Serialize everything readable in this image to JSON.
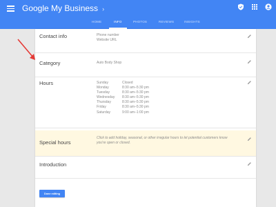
{
  "app": {
    "brand": "Google My Business",
    "brand_chevron": "›",
    "top_icons": [
      "shield-check-icon",
      "apps-grid-icon",
      "account-icon"
    ]
  },
  "tabs": [
    {
      "label": "HOME",
      "active": false
    },
    {
      "label": "INFO",
      "active": true
    },
    {
      "label": "PHOTOS",
      "active": false
    },
    {
      "label": "REVIEWS",
      "active": false
    },
    {
      "label": "INSIGHTS",
      "active": false
    }
  ],
  "contact": {
    "label": "Contact info",
    "phone_placeholder": "Phone number",
    "website_placeholder": "Website URL"
  },
  "category": {
    "label": "Category",
    "value": "Auto Body Shop"
  },
  "hours": {
    "label": "Hours",
    "days": [
      {
        "day": "Sunday",
        "time": "Closed"
      },
      {
        "day": "Monday",
        "time": "8:30 am–5:30 pm"
      },
      {
        "day": "Tuesday",
        "time": "8:30 am–5:30 pm"
      },
      {
        "day": "Wednesday",
        "time": "8:30 am–5:30 pm"
      },
      {
        "day": "Thursday",
        "time": "8:30 am–5:30 pm"
      },
      {
        "day": "Friday",
        "time": "8:30 am–5:30 pm"
      },
      {
        "day": "Saturday",
        "time": "9:00 am–1:00 pm"
      }
    ]
  },
  "special_hours": {
    "label": "Special hours",
    "hint": "Click to add holiday, seasonal, or other irregular hours to let potential customers know you're open or closed."
  },
  "introduction": {
    "label": "Introduction"
  },
  "done_button": "Done editing",
  "colors": {
    "app_bar": "#4285f4",
    "special_bg": "#fff8e1",
    "arrow": "#e53935"
  }
}
